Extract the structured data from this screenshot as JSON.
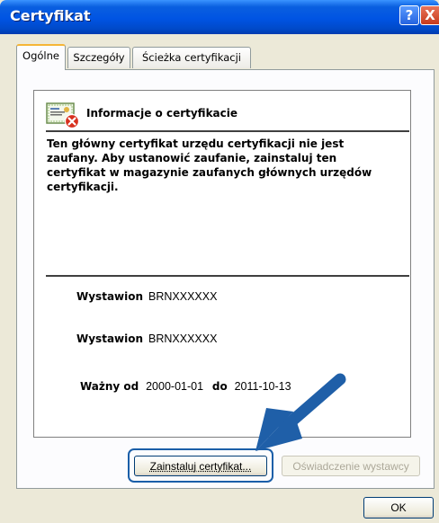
{
  "window": {
    "title": "Certyfikat",
    "help_symbol": "?",
    "close_symbol": "X"
  },
  "tabs": [
    {
      "label": "Ogólne",
      "active": true
    },
    {
      "label": "Szczegóły",
      "active": false
    },
    {
      "label": "Ścieżka certyfikacji",
      "active": false
    }
  ],
  "info": {
    "icon": "certificate-error-icon",
    "heading": "Informacje o certyfikacie",
    "status_text": "Ten główny certyfikat urzędu certyfikacji nie jest zaufany. Aby ustanowić zaufanie, zainstaluj ten certyfikat w magazynie zaufanych głównych urzędów certyfikacji."
  },
  "fields": {
    "issued_to_label": "Wystawion",
    "issued_to_value": "BRNXXXXXX",
    "issued_by_label": "Wystawion",
    "issued_by_value": "BRNXXXXXX",
    "valid_from_label": "Ważny od",
    "valid_from_value": "2000-01-01",
    "valid_to_label": "do",
    "valid_to_value": "2011-10-13"
  },
  "buttons": {
    "install": "Zainstaluj certyfikat...",
    "issuer_statement": "Oświadczenie wystawcy",
    "ok": "OK"
  },
  "colors": {
    "titlebar": "#0054e3",
    "highlight": "#1a5ea8",
    "arrow": "#1f5fa8"
  }
}
